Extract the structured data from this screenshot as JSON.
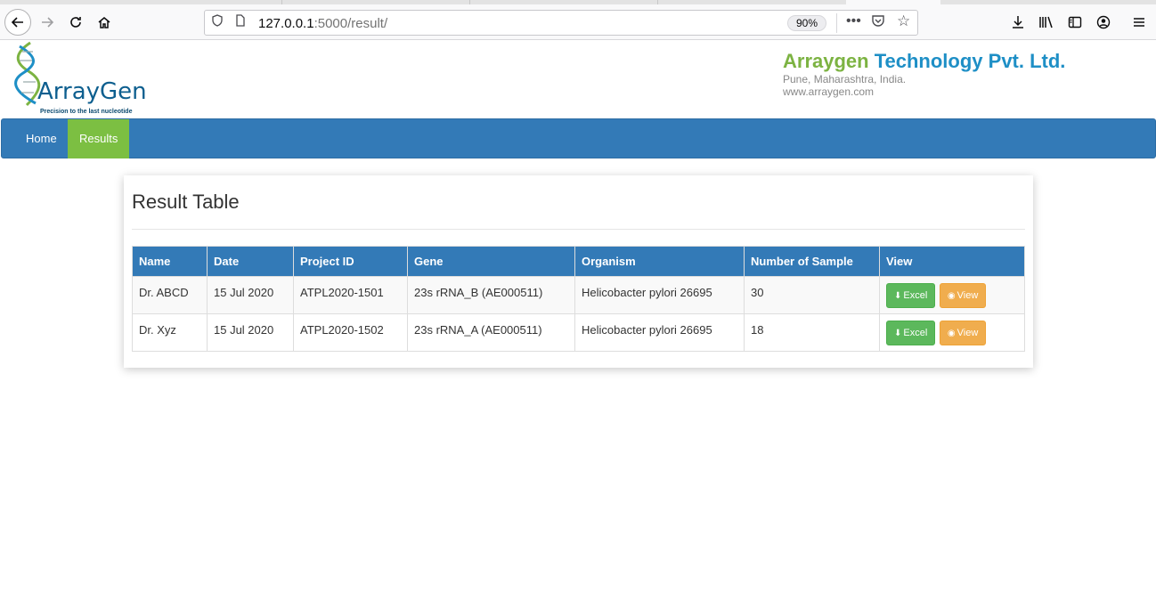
{
  "browser": {
    "url_host": "127.0.0.1",
    "url_path": ":5000/result/",
    "zoom": "90%"
  },
  "header": {
    "logo_text": "ArrayGen",
    "logo_tagline": "Precision to the last nucleotide",
    "company_name_first": "Arraygen",
    "company_name_rest": "Technology Pvt. Ltd.",
    "company_location": "Pune, Maharashtra, India.",
    "company_website": "www.arraygen.com"
  },
  "nav": {
    "items": [
      {
        "label": "Home"
      },
      {
        "label": "Results"
      }
    ]
  },
  "panel": {
    "title": "Result Table"
  },
  "table": {
    "columns": [
      "Name",
      "Date",
      "Project ID",
      "Gene",
      "Organism",
      "Number of Sample",
      "View"
    ],
    "rows": [
      {
        "name": "Dr. ABCD",
        "date": "15 Jul 2020",
        "project_id": "ATPL2020-1501",
        "gene": "23s rRNA_B (AE000511)",
        "organism": "Helicobacter pylori 26695",
        "samples": "30",
        "excel_label": "Excel",
        "view_label": "View"
      },
      {
        "name": "Dr. Xyz",
        "date": "15 Jul 2020",
        "project_id": "ATPL2020-1502",
        "gene": "23s rRNA_A (AE000511)",
        "organism": "Helicobacter pylori 26695",
        "samples": "18",
        "excel_label": "Excel",
        "view_label": "View"
      }
    ]
  },
  "colors": {
    "navbar": "#337ab7",
    "nav_active": "#7cbf42",
    "excel_button": "#5cb85c",
    "view_button": "#f0ad4e",
    "brand_green": "#7cb342",
    "brand_blue": "#1e8fc6"
  }
}
